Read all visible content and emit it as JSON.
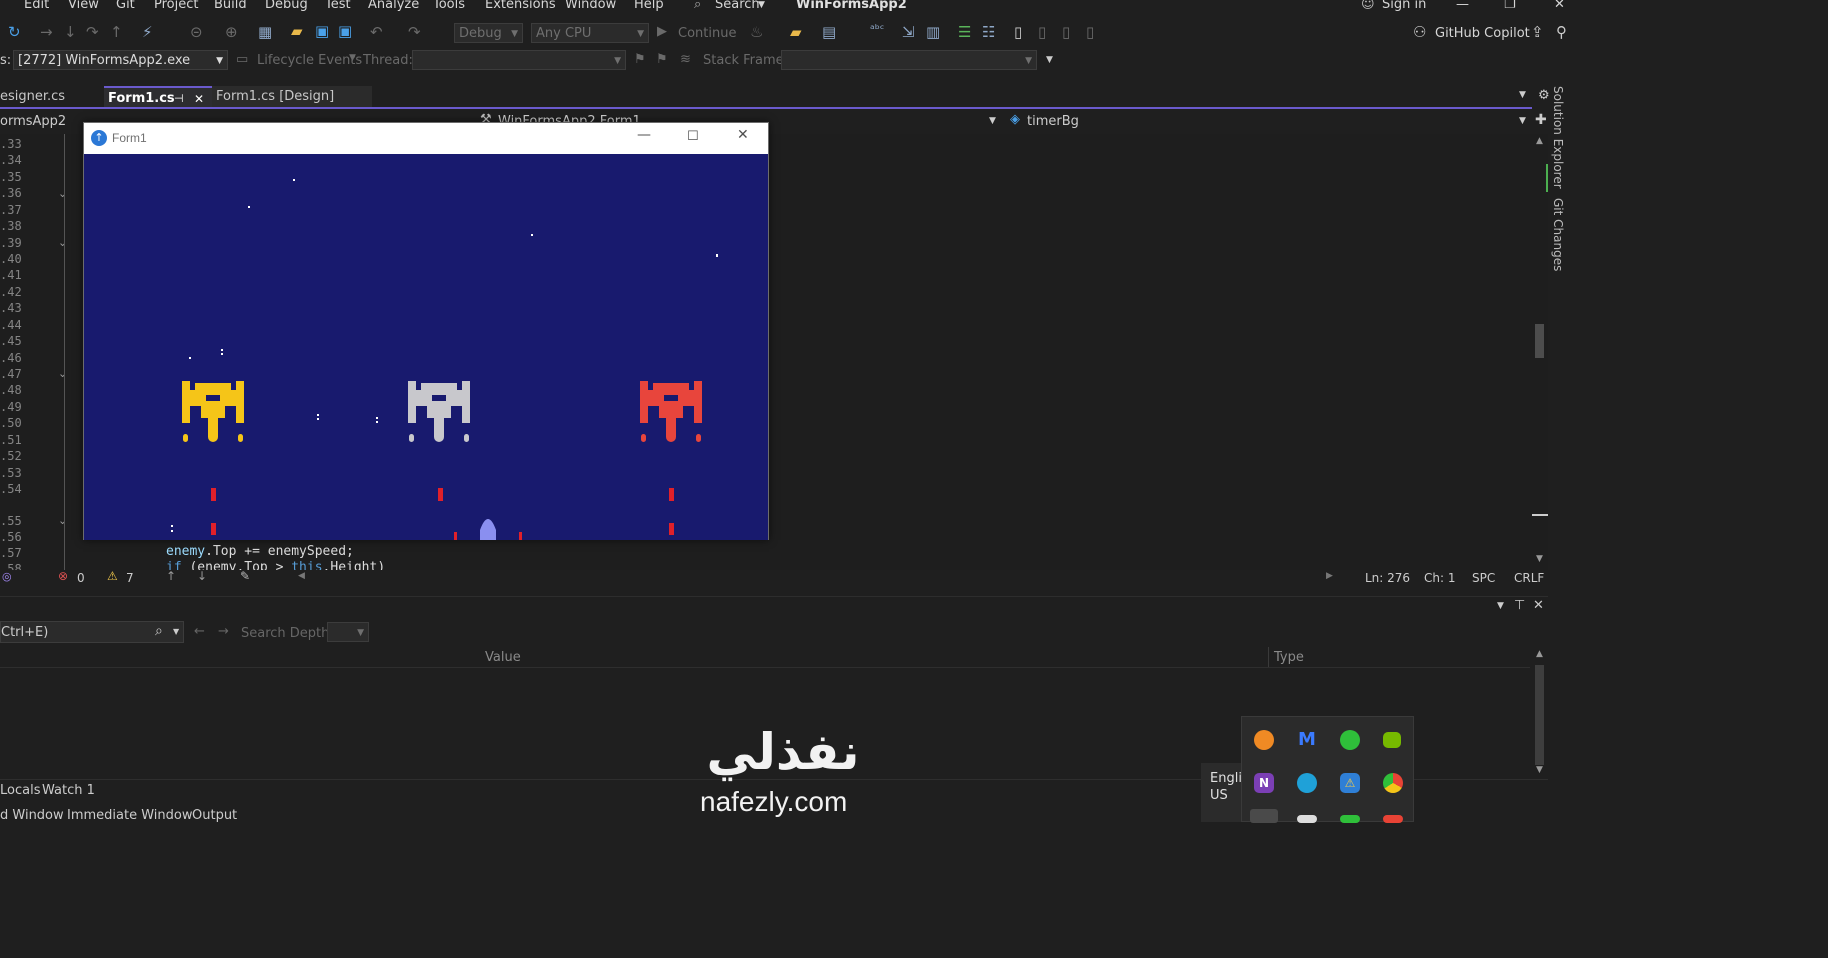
{
  "menu": {
    "items": [
      "Edit",
      "View",
      "Git",
      "Project",
      "Build",
      "Debug",
      "Test",
      "Analyze",
      "Tools",
      "Extensions",
      "Window",
      "Help"
    ],
    "search_label": "Search",
    "solution_title": "WinFormsApp2",
    "sign_in": "Sign in"
  },
  "toolbar": {
    "config": "Debug",
    "platform": "Any CPU",
    "continue_label": "Continue",
    "copilot_label": "GitHub Copilot"
  },
  "debugbar": {
    "process_label": "s:",
    "process_value": "[2772] WinFormsApp2.exe",
    "lifecycle_label": "Lifecycle Events",
    "thread_label": "Thread:",
    "stackframe_label": "Stack Frame:"
  },
  "tabs": [
    {
      "label": "esigner.cs"
    },
    {
      "label": "Form1.cs"
    },
    {
      "label": "Form1.cs [Design]"
    }
  ],
  "navbar": {
    "project": "ormsApp2",
    "class": "WinFormsApp2.Form1",
    "member": "timerBg"
  },
  "editor": {
    "line_numbers": [
      ".33",
      ".34",
      ".35",
      ".36",
      ".37",
      ".38",
      ".39",
      ".40",
      ".41",
      ".42",
      ".43",
      ".44",
      ".45",
      ".46",
      ".47",
      ".48",
      ".49",
      ".50",
      ".51",
      ".52",
      ".53",
      ".54",
      ".55",
      ".56",
      ".57",
      ".58"
    ],
    "code_line_1": {
      "a": "enemy",
      "b": ".Top += enemySpeed;"
    },
    "code_line_2": {
      "a": "if",
      "b": " (enemy.Top > ",
      "c": "this",
      "d": ".Height)"
    }
  },
  "status": {
    "errors": "0",
    "warnings": "7",
    "ln": "Ln: 276",
    "ch": "Ch: 1",
    "spc": "SPC",
    "crlf": "CRLF"
  },
  "right_rail": {
    "solution_explorer": "Solution Explorer",
    "git_changes": "Git Changes"
  },
  "form1": {
    "title": "Form1",
    "ships": [
      {
        "color": "#f5c518"
      },
      {
        "color": "#c8c8cc"
      },
      {
        "color": "#e8453c"
      }
    ],
    "background": "#181a6e",
    "bullet_color": "#e0202a"
  },
  "locals_panel": {
    "search_placeholder": "Ctrl+E)",
    "search_depth_label": "Search Depth:",
    "col_value": "Value",
    "col_type": "Type",
    "bottom_tabs": [
      "Locals",
      "Watch 1"
    ],
    "window_tabs": [
      "d Window",
      "Immediate Window",
      "Output"
    ]
  },
  "tray": {
    "lang_line1": "Englis",
    "lang_line2": "US"
  },
  "watermark": {
    "arabic": "نفذلي",
    "latin": "nafezly.com"
  }
}
